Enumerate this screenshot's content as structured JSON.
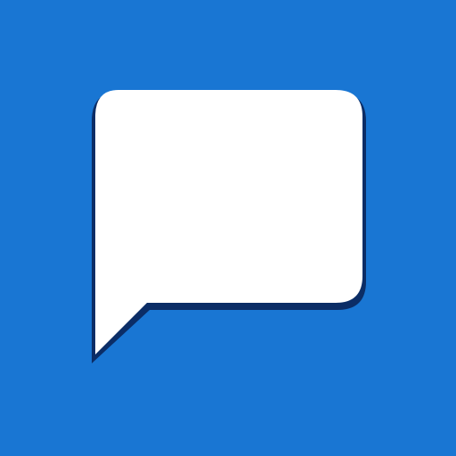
{
  "icon": {
    "name": "chat-bubble-icon",
    "colors": {
      "background": "#1976d3",
      "bubble": "#ffffff",
      "shadow": "#0b2d66"
    }
  }
}
